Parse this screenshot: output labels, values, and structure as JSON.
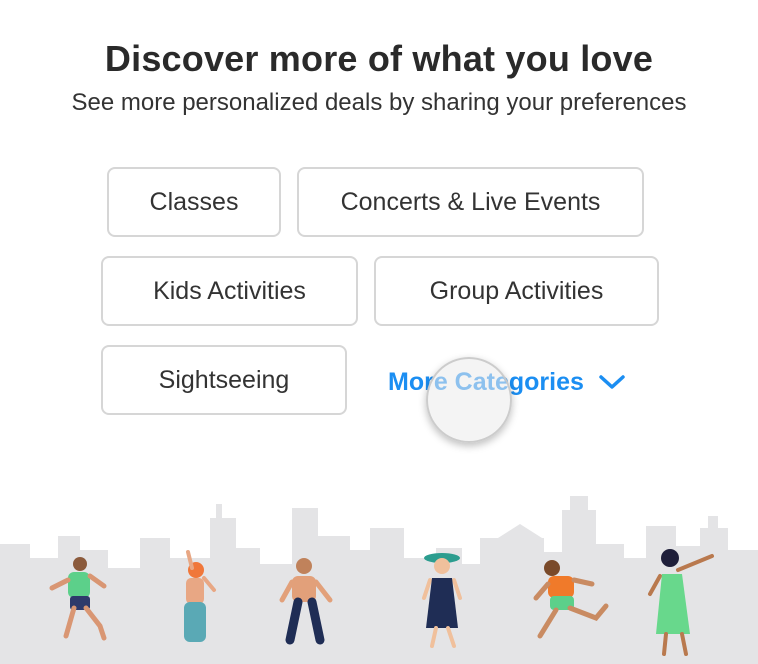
{
  "header": {
    "title": "Discover more of what you love",
    "subtitle": "See more personalized deals by sharing your preferences"
  },
  "categories": [
    {
      "label": "Classes"
    },
    {
      "label": "Concerts & Live Events"
    },
    {
      "label": "Kids Activities"
    },
    {
      "label": "Group Activities"
    },
    {
      "label": "Sightseeing"
    }
  ],
  "more_categories": {
    "label": "More Categories",
    "icon": "chevron-down-icon"
  },
  "colors": {
    "accent": "#1b8ef2",
    "chip_border": "#d6d6d6",
    "skyline": "#e4e4e6"
  }
}
